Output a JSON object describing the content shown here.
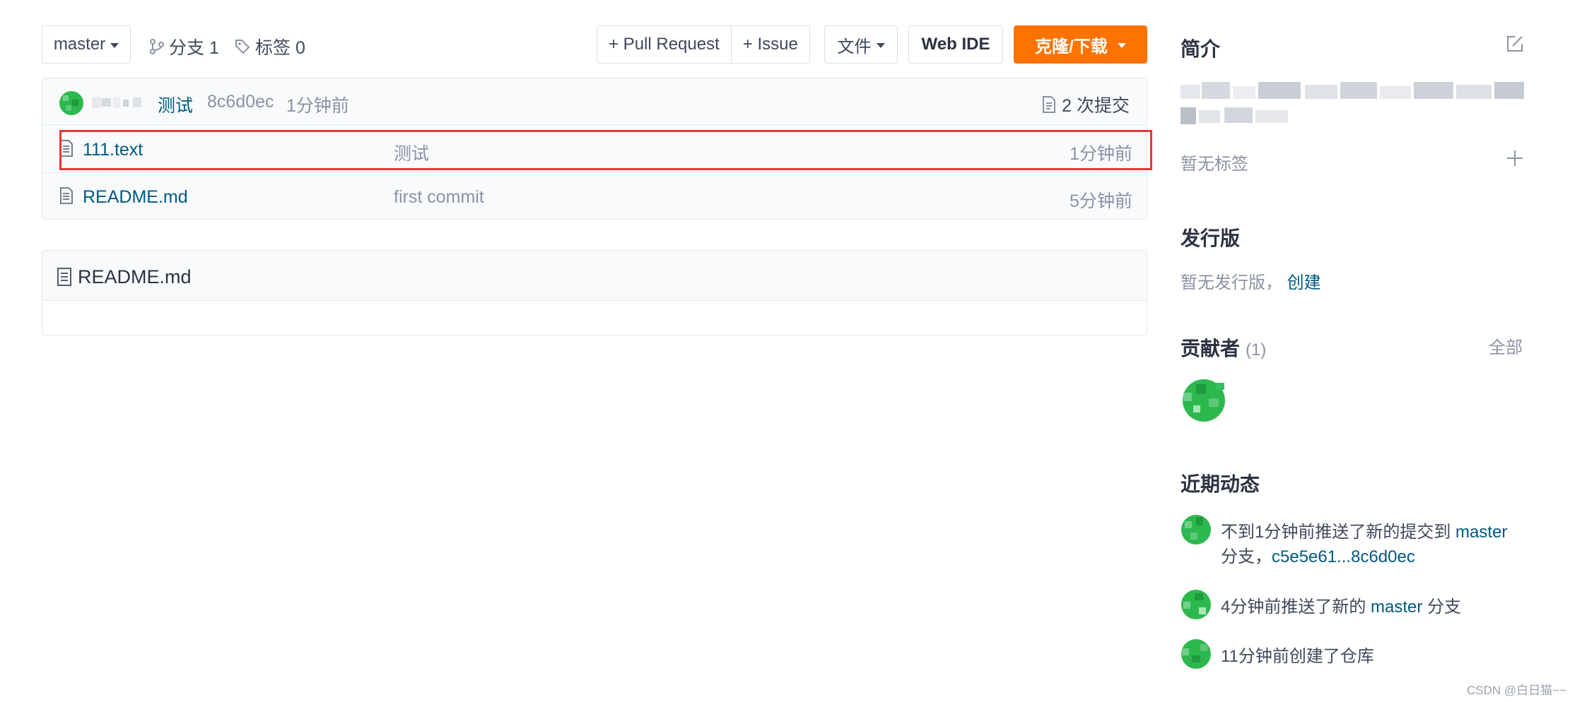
{
  "toolbar": {
    "branch_selector": "master",
    "branches_label": "分支 1",
    "tags_label": "标签 0",
    "pull_request": "+ Pull Request",
    "issue": "+ Issue",
    "files_menu": "文件",
    "web_ide": "Web IDE",
    "clone_download": "克隆/下载",
    "accent_color": "#fe7300"
  },
  "commit_bar": {
    "message": "测试",
    "sha": "8c6d0ec",
    "time": "1分钟前",
    "commit_count": "2 次提交"
  },
  "files": [
    {
      "name": "111.text",
      "commit_message": "测试",
      "time": "1分钟前",
      "icon": "file-text-icon",
      "highlighted": true
    },
    {
      "name": "README.md",
      "commit_message": "first commit",
      "time": "5分钟前",
      "icon": "file-text-icon",
      "highlighted": false
    }
  ],
  "readme": {
    "title": "README.md"
  },
  "sidebar": {
    "intro_title": "简介",
    "no_tags": "暂无标签",
    "releases_title": "发行版",
    "no_releases": "暂无发行版，",
    "create_link": "创建",
    "contributors_title": "贡献者",
    "contributors_count": "(1)",
    "all_link": "全部",
    "activity_title": "近期动态",
    "activities": [
      {
        "prefix": "不到1分钟前推送了新的提交到 ",
        "branch": "master",
        "middle": "分支，",
        "range": "c5e5e61...8c6d0ec"
      },
      {
        "prefix": "4分钟前推送了新的 ",
        "branch": "master",
        "suffix": " 分支"
      },
      {
        "text": "11分钟前创建了仓库"
      }
    ]
  },
  "watermark": "CSDN @白日猫~~"
}
